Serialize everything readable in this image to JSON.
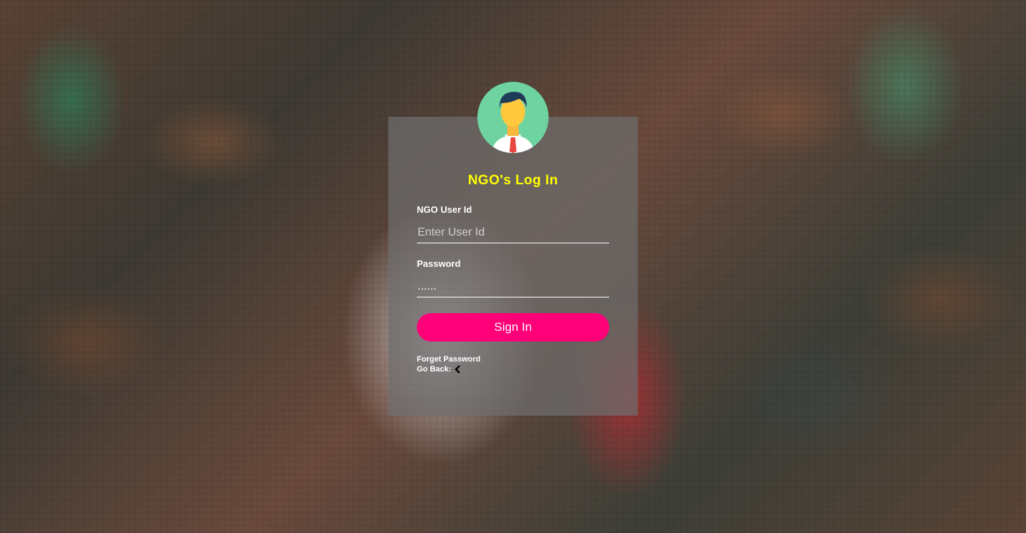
{
  "login": {
    "title": "NGO's Log In",
    "user_id_label": "NGO User Id",
    "user_id_placeholder": "Enter User Id",
    "password_label": "Password",
    "password_value": "......",
    "sign_in_label": "Sign In",
    "forgot_password": "Forget Password",
    "go_back": "Go Back:"
  },
  "colors": {
    "title": "#ffff00",
    "button": "#ff0078",
    "avatar_bg": "#6fd3a1"
  },
  "icons": {
    "avatar": "user-avatar-icon",
    "go_back": "chevron-left-icon"
  }
}
